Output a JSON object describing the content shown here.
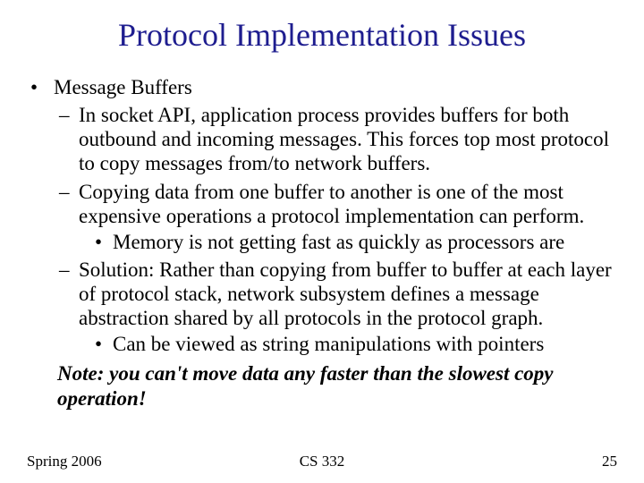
{
  "title": "Protocol Implementation Issues",
  "bullets": {
    "l1": "Message Buffers",
    "l2a": "In socket API, application process provides buffers for both outbound and incoming messages.  This forces top most protocol to copy messages from/to network buffers.",
    "l2b": "Copying data from one buffer to another is one of the most expensive operations a protocol implementation can perform.",
    "l3b": "Memory is not getting fast as quickly as processors are",
    "l2c": "Solution: Rather than copying from buffer to buffer at each layer of protocol stack, network subsystem defines a message abstraction shared by all protocols in the protocol graph.",
    "l3c": "Can be viewed as string manipulations with pointers",
    "note": "Note: you can't move data any faster than the slowest copy operation!"
  },
  "footer": {
    "left": "Spring 2006",
    "center": "CS 332",
    "right": "25"
  }
}
